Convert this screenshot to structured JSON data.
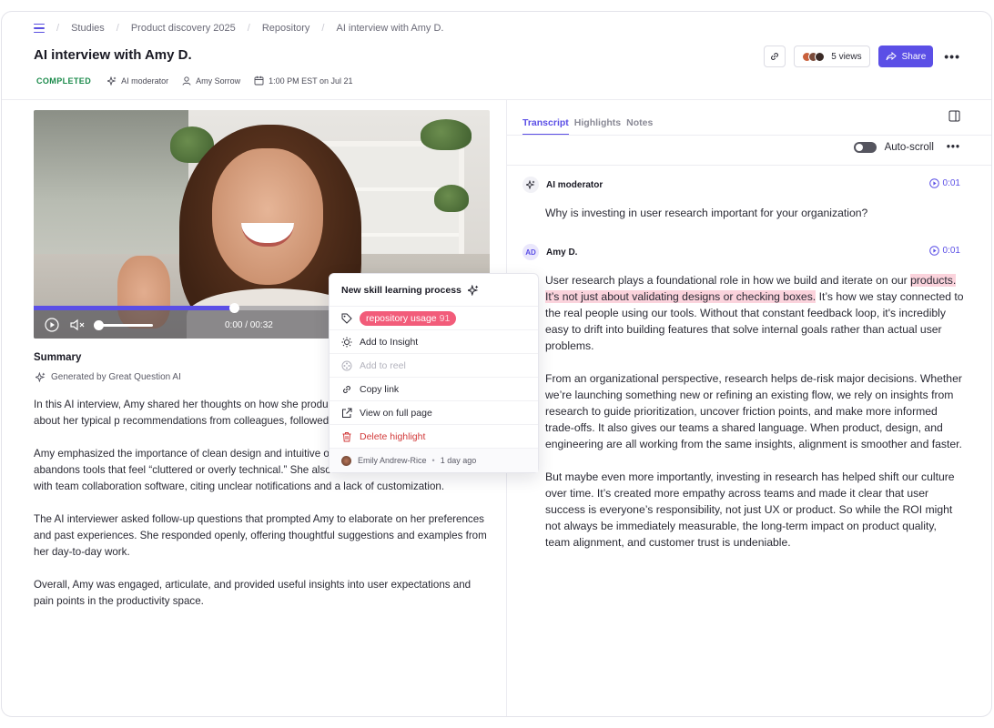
{
  "breadcrumb": {
    "items": [
      "Studies",
      "Product discovery 2025",
      "Repository",
      "AI interview with Amy D."
    ]
  },
  "page": {
    "title": "AI interview with Amy D.",
    "status": "COMPLETED",
    "moderator": "AI moderator",
    "owner": "Amy Sorrow",
    "scheduled": "1:00 PM EST on Jul 21"
  },
  "header": {
    "views_label": "5 views",
    "share_label": "Share",
    "more": "•••"
  },
  "video": {
    "time": "0:00 / 00:32",
    "progress": 0.44,
    "volume": 0.0
  },
  "summary": {
    "title": "Summary",
    "generated_by": "Generated by Great Question AI",
    "paragraphs": [
      "In this AI interview, Amy shared her thoughts on how she productivity tools for work. She spoke about her typical p recommendations from colleagues, followed by quick har her workflow.",
      "Amy emphasized the importance of clean design and intuitive onboarding, saying she often abandons tools that feel “cluttered or overly technical.” She also reflected on recent frustrations with team collaboration software, citing unclear notifications and a lack of customization.",
      "The AI interviewer asked follow-up questions that prompted Amy to elaborate on her preferences and past experiences. She responded openly, offering thoughtful suggestions and examples from her day-to-day work.",
      "Overall, Amy was engaged, articulate, and provided useful insights into user expectations and pain points in the productivity space."
    ]
  },
  "popover": {
    "title": "New skill learning process",
    "tag_label": "repository usage",
    "tag_count": "91",
    "add_to_insight": "Add to Insight",
    "add_to_reel": "Add to reel",
    "copy_link": "Copy link",
    "view_full_page": "View on full page",
    "delete_highlight": "Delete highlight",
    "author": "Emily Andrew-Rice",
    "time_ago": "1 day ago"
  },
  "transcript": {
    "tabs": [
      "Transcript",
      "Highlights",
      "Notes"
    ],
    "autoscroll_label": "Auto-scroll",
    "more": "•••",
    "entries": [
      {
        "speaker": "AI moderator",
        "time": "0:01",
        "text": "Why is investing in user research important for your organization?"
      },
      {
        "speaker": "Amy D.",
        "initials": "AD",
        "time": "0:01",
        "p1_before": "User research plays a foundational role in how we build and iterate on our ",
        "p1_highlight": "products. It’s not just about validating designs or checking boxes.",
        "p1_after": " It’s how we stay connected to the real people using our tools. Without that constant feedback loop, it's incredibly easy to drift into building features that solve internal goals rather than actual user problems.",
        "p2": "From an organizational perspective, research helps de-risk major decisions. Whether we’re launching something new or refining an existing flow, we rely on insights from research to guide prioritization, uncover friction points, and make more informed trade-offs. It also gives our teams a shared language. When product, design, and engineering are all working from the same insights, alignment is smoother and faster.",
        "p3": "But maybe even more importantly, investing in research has helped shift our culture over time. It’s created more empathy across teams and made it clear that user success is everyone’s responsibility, not just UX or product. So while the ROI might not always be immediately measurable, the long-term impact on product quality, team alignment, and customer trust is undeniable."
      }
    ]
  },
  "colors": {
    "accent": "#5b4fe6",
    "status_green": "#1a8a4a",
    "tag_pink": "#f25c7a",
    "highlight": "#fbd3dc",
    "danger": "#d23b3b"
  },
  "icons": [
    "menu-icon",
    "sparkle-icon",
    "user-icon",
    "calendar-icon",
    "link-icon",
    "share-icon",
    "play-icon",
    "mute-icon",
    "tag-icon",
    "insight-icon",
    "reel-icon",
    "external-icon",
    "trash-icon",
    "panel-icon",
    "timestamp-play-icon"
  ]
}
